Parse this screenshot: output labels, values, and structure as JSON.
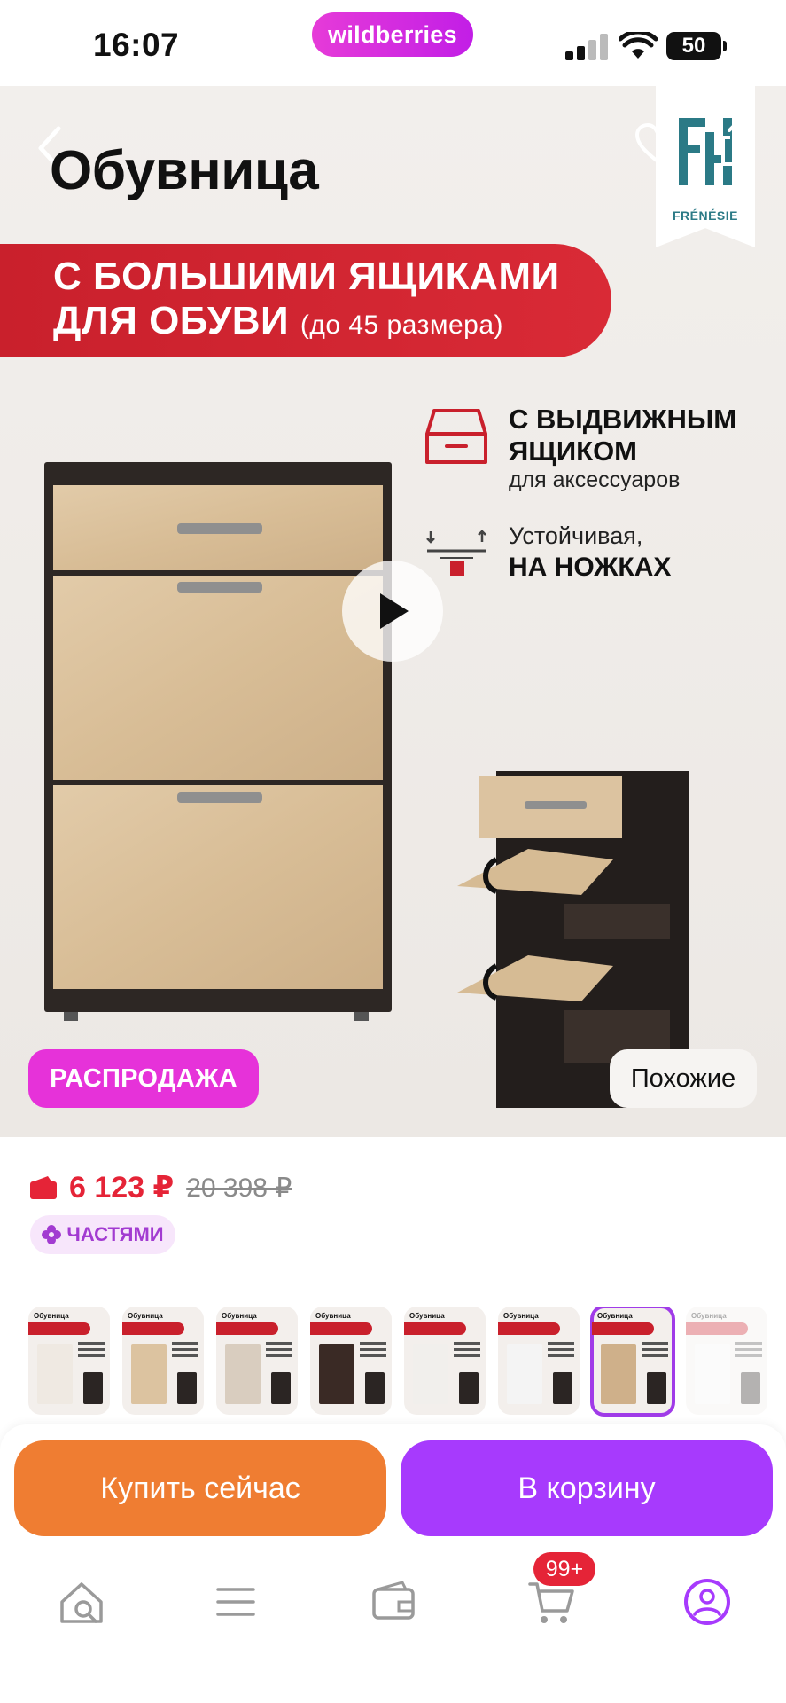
{
  "status_bar": {
    "time": "16:07",
    "brand": "wildberries",
    "battery": "50"
  },
  "product_image": {
    "title": "Обувница",
    "ribbon_line1": "С БОЛЬШИМИ ЯЩИКАМИ",
    "ribbon_line2": "ДЛЯ ОБУВИ",
    "ribbon_note": "(до 45 размера)",
    "feature1_title_line1": "С ВЫДВИЖНЫМ",
    "feature1_title_line2": "ЯЩИКОМ",
    "feature1_sub": "для аксессуаров",
    "feature2_line1": "Устойчивая,",
    "feature2_line2": "НА НОЖКАХ",
    "brand_name": "FRÉNÉSIE",
    "sale_badge": "РАСПРОДАЖА",
    "similar_button": "Похожие"
  },
  "price": {
    "current": "6 123 ₽",
    "old": "20 398 ₽",
    "installments": "ЧАСТЯМИ"
  },
  "thumbnails": [
    {
      "title": "Обувница",
      "color": "#efe9e2"
    },
    {
      "title": "Обувница",
      "color": "#dcc3a0"
    },
    {
      "title": "Обувница",
      "color": "#d9cdbf"
    },
    {
      "title": "Обувница",
      "color": "#3a2a25"
    },
    {
      "title": "Обувница",
      "color": "#f1efec"
    },
    {
      "title": "Обувница",
      "color": "#f4f4f4"
    },
    {
      "title": "Обувница",
      "color": "#cfb08a"
    },
    {
      "title": "Обувница",
      "color": "#f6f6f6"
    }
  ],
  "actions": {
    "buy_now": "Купить сейчас",
    "add_to_cart": "В корзину"
  },
  "bottom_nav": {
    "cart_badge": "99+"
  },
  "colors": {
    "brand_pink": "#e63bd8",
    "price_red": "#e52437",
    "buy_orange": "#ef7d32",
    "cart_purple": "#a73afd"
  }
}
